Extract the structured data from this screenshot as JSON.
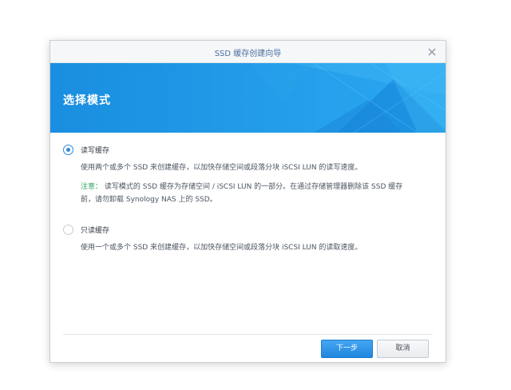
{
  "window": {
    "title": "SSD 缓存创建向导",
    "close_icon": "close-icon"
  },
  "banner": {
    "heading": "选择模式"
  },
  "options": [
    {
      "label": "读写缓存",
      "selected": true,
      "description": "使用两个或多个 SSD 来创建缓存，以加快存储空间或段落分块 iSCSI LUN 的读写速度。",
      "note_key": "注意：",
      "note_line1": " 读写模式的 SSD 缓存为存储空间 / iSCSI LUN 的一部分。在通过存储管理器删除该 SSD 缓存",
      "note_line2": "前，请勿卸载 Synology NAS 上的 SSD。"
    },
    {
      "label": "只读缓存",
      "selected": false,
      "description": "使用一个或多个 SSD 来创建缓存，以加快存储空间或段落分块 iSCSI LUN 的读取速度。"
    }
  ],
  "footer": {
    "next_label": "下一步",
    "cancel_label": "取消"
  },
  "colors": {
    "accent": "#1f86de",
    "banner": "#1b8fe0",
    "note": "#2aa35a"
  }
}
